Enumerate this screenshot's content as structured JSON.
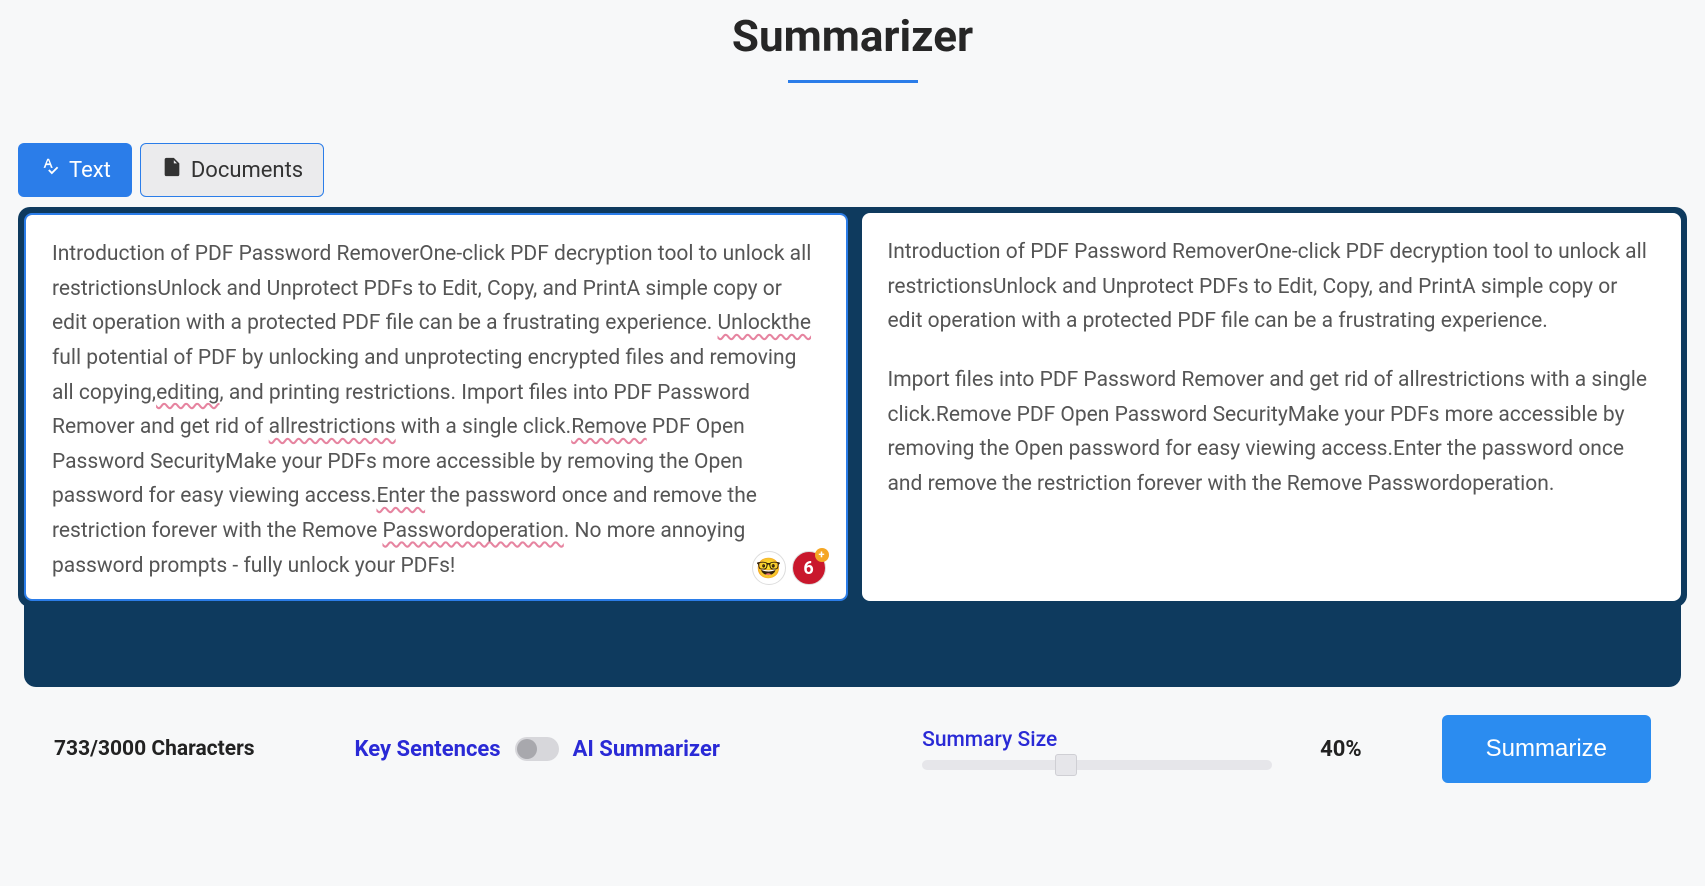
{
  "title": "Summarizer",
  "tabs": {
    "text": "Text",
    "documents": "Documents"
  },
  "input_text_parts": [
    {
      "t": "Introduction of PDF Password RemoverOne-click PDF decryption tool to unlock all restrictionsUnlock and Unprotect PDFs to Edit, Copy, and PrintA simple copy or edit operation with a protected PDF file can be a frustrating experience. "
    },
    {
      "t": "Unlockthe",
      "err": true
    },
    {
      "t": " full potential of PDF by unlocking and unprotecting encrypted files and removing all copying,"
    },
    {
      "t": "editing",
      "err": true
    },
    {
      "t": ", and printing restrictions. Import files into PDF Password Remover and get rid of "
    },
    {
      "t": "allrestrictions",
      "err": true
    },
    {
      "t": " with a single click."
    },
    {
      "t": "Remove",
      "err": true
    },
    {
      "t": " PDF Open Password SecurityMake your PDFs more accessible by removing the Open password for easy viewing access."
    },
    {
      "t": "Enter",
      "err": true
    },
    {
      "t": " the password once and remove the restriction forever with the Remove "
    },
    {
      "t": "Passwordoperation",
      "err": true
    },
    {
      "t": ". No more annoying password prompts - fully unlock your PDFs!"
    }
  ],
  "output_text_p1": "Introduction of PDF Password RemoverOne-click PDF decryption tool to unlock all restrictionsUnlock and Unprotect PDFs to Edit, Copy, and PrintA simple copy or edit operation with a protected PDF file can be a frustrating experience.",
  "output_text_p2": "Import files into PDF Password Remover and get rid of allrestrictions with a single click.Remove PDF Open Password SecurityMake your PDFs more accessible by removing the Open password for easy viewing access.Enter the password once and remove the restriction forever with the Remove Passwordoperation.",
  "error_badge": "6",
  "char_count": "733/3000 Characters",
  "mode": {
    "key_sentences": "Key Sentences",
    "ai_summarizer": "AI Summarizer"
  },
  "summary_size_label": "Summary Size",
  "summary_size_pct": "40%",
  "summary_size_value": 40,
  "summarize_btn": "Summarize"
}
